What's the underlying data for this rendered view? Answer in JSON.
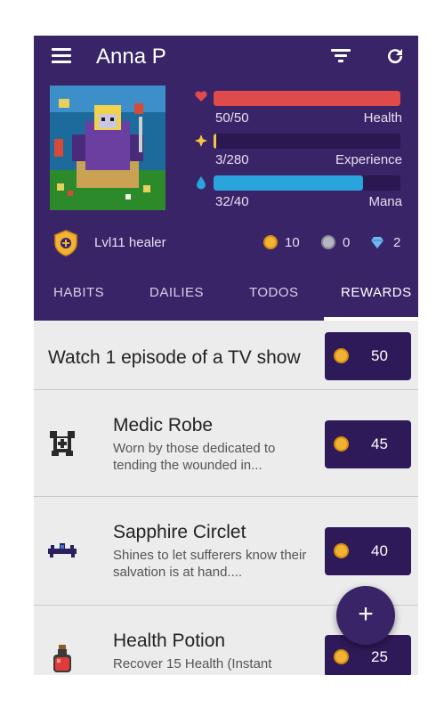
{
  "app": {
    "user_name": "Anna P",
    "icons": {
      "menu": "hamburger-menu-icon",
      "filter": "filter-icon",
      "refresh": "refresh-icon"
    }
  },
  "profile": {
    "avatar": "pixel-art-avatar",
    "bars": {
      "health": {
        "value_text": "50/50",
        "label": "Health",
        "fraction": 1.0,
        "color": "#e04a4a"
      },
      "experience": {
        "value_text": "3/280",
        "label": "Experience",
        "fraction": 0.011,
        "color": "#f5c542"
      },
      "mana": {
        "value_text": "32/40",
        "label": "Mana",
        "fraction": 0.8,
        "color": "#2aa4dc"
      }
    },
    "level_text": "Lvl11 healer",
    "gold": "10",
    "silver": "0",
    "gems": "2"
  },
  "tabs": [
    {
      "label": "HABITS"
    },
    {
      "label": "DAILIES"
    },
    {
      "label": "TODOS"
    },
    {
      "label": "REWARDS",
      "active": true
    }
  ],
  "rewards": [
    {
      "title": "Watch 1 episode of a TV show",
      "desc": "",
      "price": "50",
      "icon": ""
    },
    {
      "title": "Medic Robe",
      "desc": "Worn by those dedicated to tending the wounded in...",
      "price": "45",
      "icon": "medic-robe-icon"
    },
    {
      "title": "Sapphire Circlet",
      "desc": "Shines to let sufferers know their salvation is at hand....",
      "price": "40",
      "icon": "sapphire-circlet-icon"
    },
    {
      "title": "Health Potion",
      "desc": "Recover 15 Health (Instant",
      "price": "25",
      "icon": "health-potion-icon"
    }
  ],
  "fab": {
    "label": "+"
  }
}
